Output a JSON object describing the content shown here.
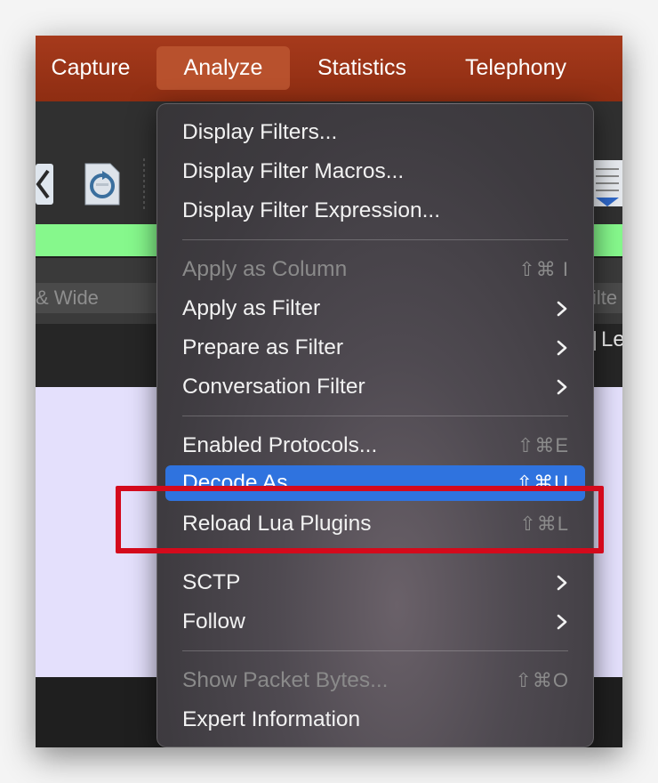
{
  "menubar": {
    "items": [
      {
        "label": "Capture"
      },
      {
        "label": "Analyze"
      },
      {
        "label": "Statistics"
      },
      {
        "label": "Telephony"
      }
    ]
  },
  "background": {
    "column_label_left": "& Wide",
    "column_label_right": "ilte",
    "right_column_text": "Le"
  },
  "menu": {
    "items": [
      {
        "label": "Display Filters..."
      },
      {
        "label": "Display Filter Macros..."
      },
      {
        "label": "Display Filter Expression..."
      },
      {
        "label": "Apply as Column",
        "shortcut": "⇧⌘ I"
      },
      {
        "label": "Apply as Filter"
      },
      {
        "label": "Prepare as Filter"
      },
      {
        "label": "Conversation Filter"
      },
      {
        "label": "Enabled Protocols...",
        "shortcut": "⇧⌘E"
      },
      {
        "label": "Decode As...",
        "shortcut": "⇧⌘U"
      },
      {
        "label": "Reload Lua Plugins",
        "shortcut": "⇧⌘L"
      },
      {
        "label": "SCTP"
      },
      {
        "label": "Follow"
      },
      {
        "label": "Show Packet Bytes...",
        "shortcut": "⇧⌘O"
      },
      {
        "label": "Expert Information"
      }
    ]
  },
  "colors": {
    "menubar": "#9a3418",
    "menubar_active": "#b8512d",
    "highlight": "#2f73df",
    "annotation": "#d40a1c",
    "filter_bar": "#86f88c",
    "packet_list": "#e4e0fc"
  },
  "icons": [
    "chevron-left-icon",
    "reload-file-icon",
    "document-icon",
    "chevron-right-icon"
  ]
}
